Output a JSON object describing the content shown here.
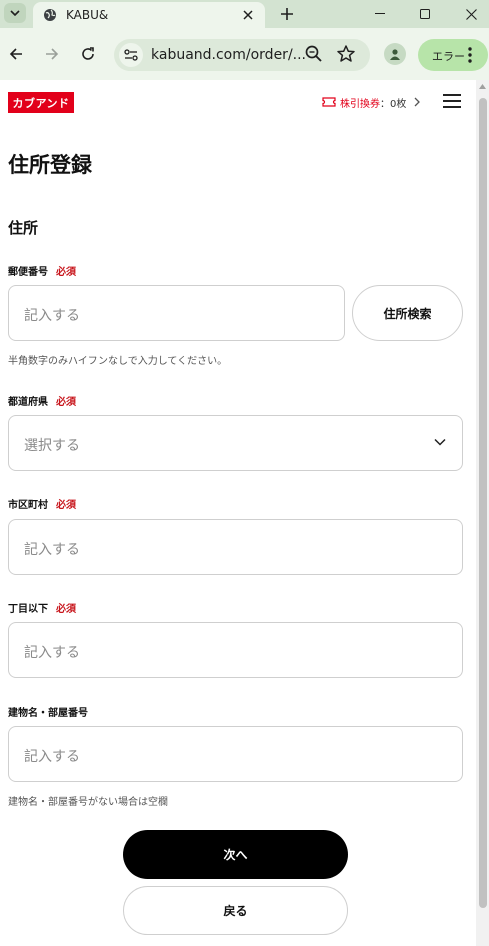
{
  "browser": {
    "tab_title": "KABU&",
    "url": "kabuand.com/order/...",
    "error_chip_label": "エラー"
  },
  "header": {
    "logo_text": "カブアンド",
    "ticket_label": "株引換券",
    "ticket_count": "：0枚"
  },
  "page": {
    "title": "住所登録",
    "section_title": "住所"
  },
  "form": {
    "required_label": "必須",
    "postal": {
      "label": "郵便番号",
      "placeholder": "記入する",
      "help": "半角数字のみハイフンなしで入力してください。"
    },
    "address_search_label": "住所検索",
    "prefecture": {
      "label": "都道府県",
      "value": "選択する"
    },
    "city": {
      "label": "市区町村",
      "placeholder": "記入する"
    },
    "street": {
      "label": "丁目以下",
      "placeholder": "記入する"
    },
    "building": {
      "label": "建物名・部屋番号",
      "placeholder": "記入する",
      "help": "建物名・部屋番号がない場合は空欄"
    }
  },
  "buttons": {
    "next": "次へ",
    "back": "戻る"
  },
  "colors": {
    "brand_red": "#e2001a",
    "required_red": "#c8161d",
    "chrome_frame": "#d3e3d1",
    "chrome_toolbar": "#eef5ec"
  }
}
